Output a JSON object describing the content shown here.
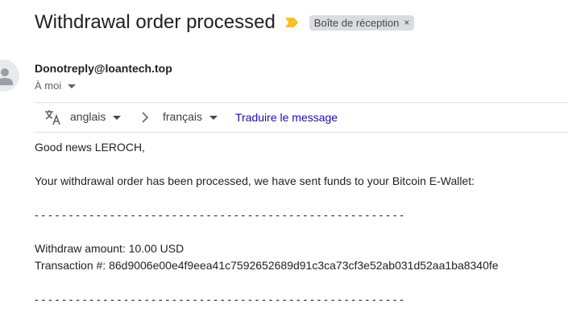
{
  "email": {
    "subject": "Withdrawal order processed",
    "label": "Boîte de réception",
    "label_remove": "×",
    "sender": "Donotreply@loantech.top",
    "recipient": "À moi"
  },
  "translate": {
    "source_lang": "anglais",
    "target_lang": "français",
    "action": "Traduire le message"
  },
  "body": {
    "greeting": "Good news LEROCH,",
    "message": "Your withdrawal order has been processed, we have sent funds to your Bitcoin E-Wallet:",
    "separator": "- - - - - - - - - - - - - - - - - - - - - - - - - - - - - - - - - - - - - - - - - - - - - - - - - - - - - -",
    "amount_line": "Withdraw amount: 10.00 USD",
    "transaction_line": "Transaction #: 86d9006e00e4f9eea41c7592652689d91c3ca73cf3e52ab031d52aa1ba8340fe"
  },
  "icons": {
    "important": "important-marker-icon",
    "avatar": "person-icon",
    "translate": "translate-icon",
    "arrow": "chevron-right-icon"
  },
  "colors": {
    "important_marker": "#f6c026",
    "link": "#1a0dab",
    "chip_bg": "#dadce0"
  }
}
